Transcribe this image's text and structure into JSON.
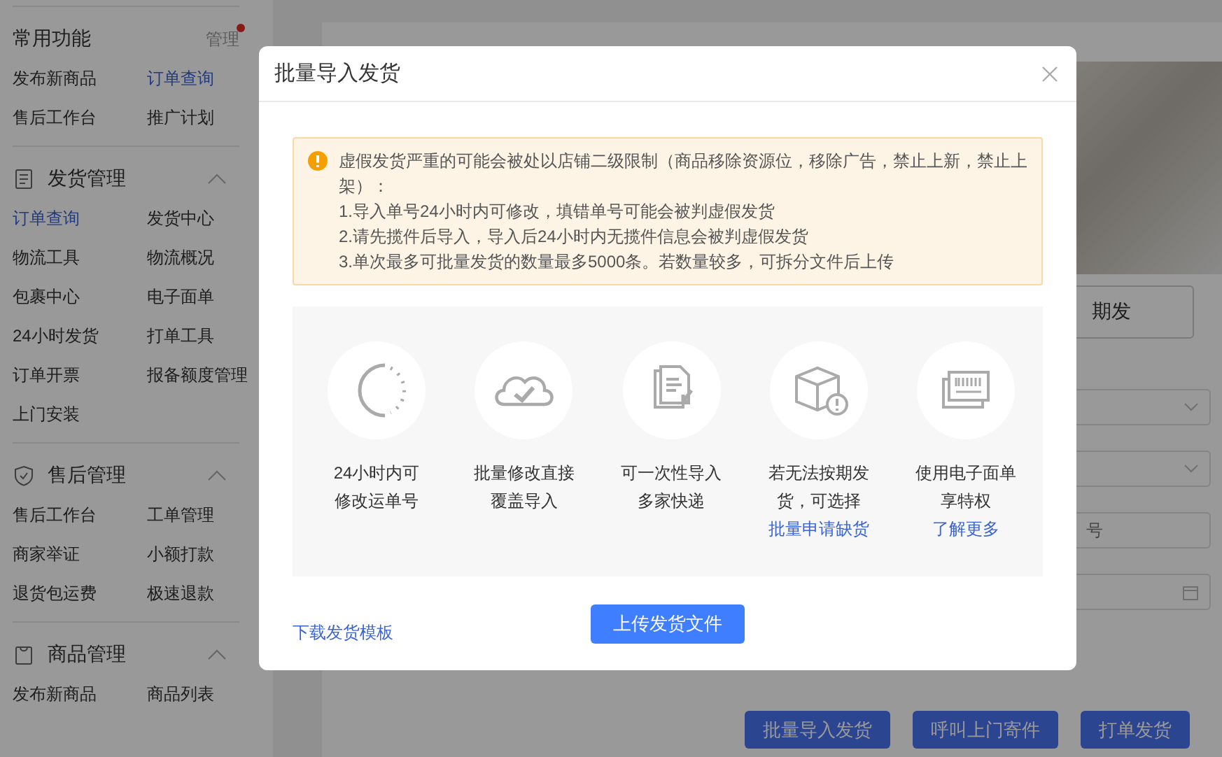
{
  "sidebar": {
    "sections": [
      {
        "title": "常用功能",
        "action": {
          "label": "管理",
          "notification": true
        },
        "items": [
          {
            "label": "发布新商品",
            "selected": false
          },
          {
            "label": "订单查询",
            "selected": true
          },
          {
            "label": "售后工作台",
            "selected": false
          },
          {
            "label": "推广计划",
            "selected": false
          }
        ]
      },
      {
        "title": "发货管理",
        "expanded": true,
        "items": [
          {
            "label": "订单查询",
            "selected": true
          },
          {
            "label": "发货中心",
            "selected": false
          },
          {
            "label": "物流工具",
            "selected": false
          },
          {
            "label": "物流概况",
            "selected": false
          },
          {
            "label": "包裹中心",
            "selected": false
          },
          {
            "label": "电子面单",
            "selected": false
          },
          {
            "label": "24小时发货",
            "selected": false
          },
          {
            "label": "打单工具",
            "selected": false
          },
          {
            "label": "订单开票",
            "selected": false
          },
          {
            "label": "报备额度管理",
            "selected": false
          },
          {
            "label": "上门安装",
            "selected": false
          }
        ]
      },
      {
        "title": "售后管理",
        "expanded": true,
        "items": [
          {
            "label": "售后工作台",
            "selected": false
          },
          {
            "label": "工单管理",
            "selected": false
          },
          {
            "label": "商家举证",
            "selected": false
          },
          {
            "label": "小额打款",
            "selected": false
          },
          {
            "label": "退货包运费",
            "selected": false
          },
          {
            "label": "极速退款",
            "selected": false
          }
        ]
      },
      {
        "title": "商品管理",
        "expanded": true,
        "items": [
          {
            "label": "发布新商品",
            "selected": false
          },
          {
            "label": "商品列表",
            "selected": false
          }
        ]
      }
    ]
  },
  "background": {
    "filter_button": "期发",
    "fields": [
      {
        "kind": "select"
      },
      {
        "kind": "select"
      },
      {
        "kind": "text",
        "placeholder": "号"
      },
      {
        "kind": "date"
      }
    ],
    "action_buttons": [
      "批量导入发货",
      "呼叫上门寄件",
      "打单发货"
    ]
  },
  "modal": {
    "title": "批量导入发货",
    "notice": {
      "message": "虚假发货严重的可能会被处以店铺二级限制（商品移除资源位，移除广告，禁止上新，禁止上架）：",
      "items": [
        "1.导入单号24小时内可修改，填错单号可能会被判虚假发货",
        "2.请先揽件后导入，导入后24小时内无揽件信息会被判虚假发货",
        "3.单次最多可批量发货的数量最多5000条。若数量较多，可拆分文件后上传"
      ]
    },
    "features": [
      {
        "lines": [
          "24小时内可",
          "修改运单号"
        ]
      },
      {
        "lines": [
          "批量修改直接",
          "覆盖导入"
        ]
      },
      {
        "lines": [
          "可一次性导入",
          "多家快递"
        ]
      },
      {
        "lines": [
          "若无法按期发",
          "货，可选择"
        ],
        "link": "批量申请缺货"
      },
      {
        "lines": [
          "使用电子面单",
          "享特权"
        ],
        "link": "了解更多"
      }
    ],
    "template_link": "下载发货模板",
    "upload_button": "上传发货文件"
  }
}
